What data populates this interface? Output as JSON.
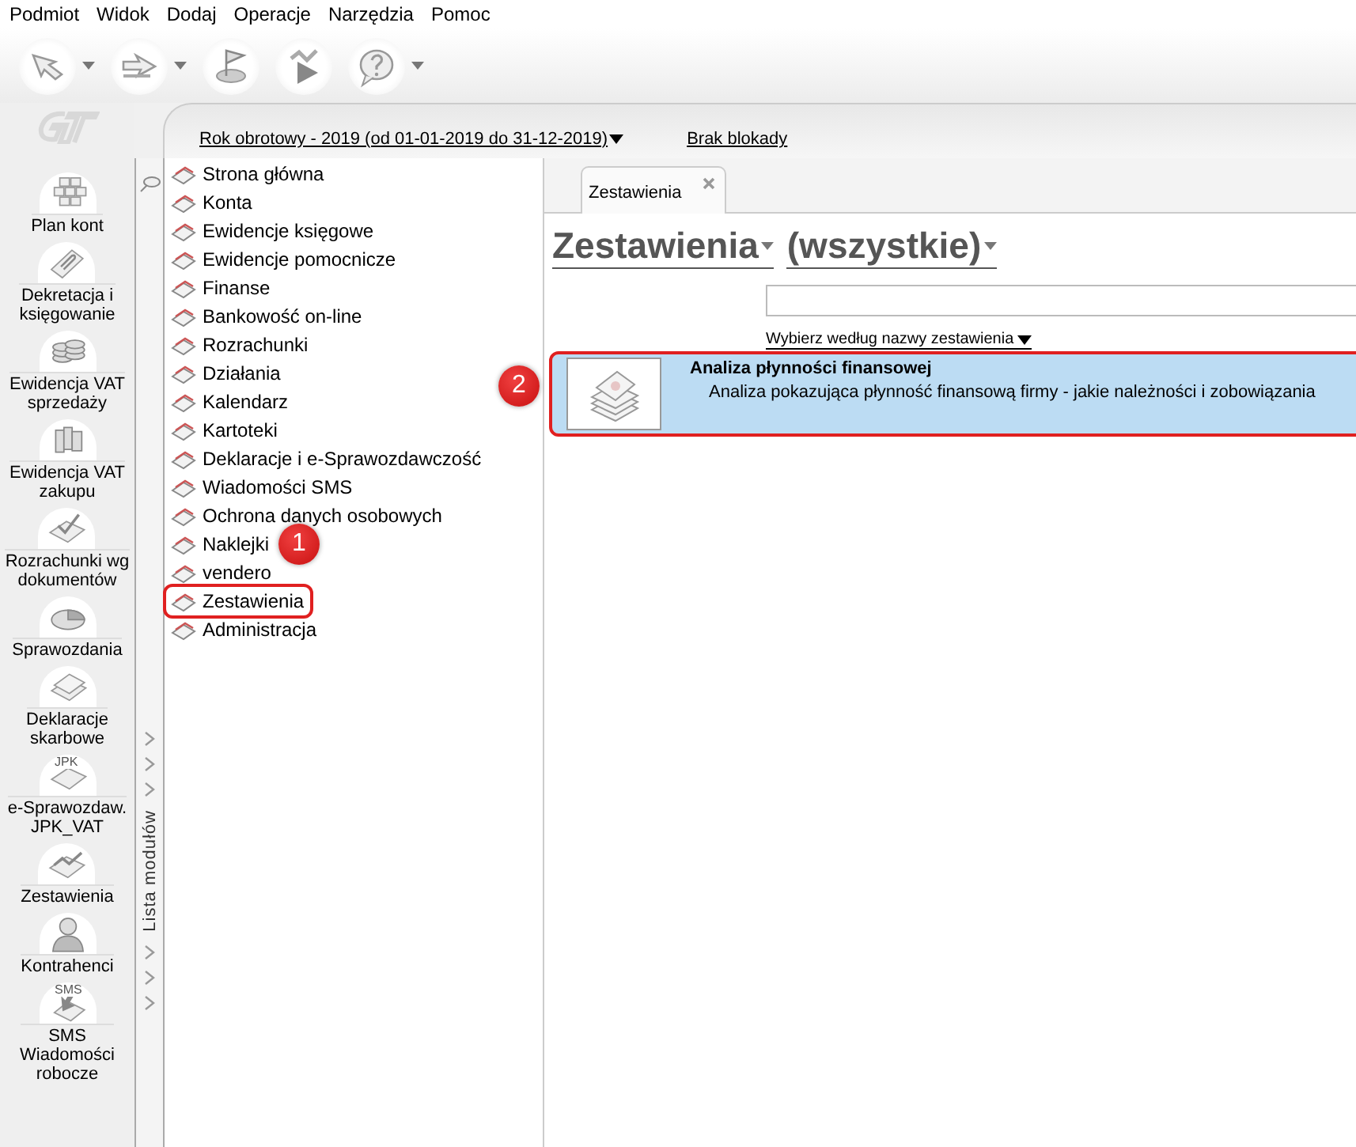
{
  "menu": [
    "Podmiot",
    "Widok",
    "Dodaj",
    "Operacje",
    "Narzędzia",
    "Pomoc"
  ],
  "toolbar": [
    {
      "kind": "arrow-left",
      "dropdown": true
    },
    {
      "kind": "arrow-right",
      "dropdown": true
    },
    {
      "kind": "flag",
      "dropdown": false
    },
    {
      "kind": "play",
      "dropdown": false
    },
    {
      "kind": "help",
      "dropdown": true
    }
  ],
  "sidebar": {
    "items": [
      {
        "label": "Plan kont",
        "kind": "grid"
      },
      {
        "label": "Dekretacja i\nksięgowanie",
        "kind": "clip"
      },
      {
        "label": "Ewidencja VAT\nsprzedaży",
        "kind": "coins"
      },
      {
        "label": "Ewidencja VAT\nzakupu",
        "kind": "binders"
      },
      {
        "label": "Rozrachunki wg\ndokumentów",
        "kind": "check"
      },
      {
        "label": "Sprawozdania",
        "kind": "pie"
      },
      {
        "label": "Deklaracje\nskarbowe",
        "kind": "stack"
      },
      {
        "label": "e-Sprawozdaw.\nJPK_VAT",
        "kind": "jpk",
        "badge": "JPK"
      },
      {
        "label": "Zestawienia",
        "kind": "chart"
      },
      {
        "label": "Kontrahenci",
        "kind": "person"
      },
      {
        "label": "SMS\nWiadomości\nrobocze",
        "kind": "sms",
        "badge": "SMS"
      }
    ]
  },
  "header": {
    "fiscal_year": "Rok obrotowy - 2019  (od 01-01-2019 do 31-12-2019)",
    "lock": "Brak blokady"
  },
  "module_strip": {
    "label": "Lista modułów"
  },
  "modules": [
    {
      "label": "Strona główna",
      "highlighted": false
    },
    {
      "label": "Konta",
      "highlighted": false
    },
    {
      "label": "Ewidencje księgowe",
      "highlighted": false
    },
    {
      "label": "Ewidencje pomocnicze",
      "highlighted": false
    },
    {
      "label": "Finanse",
      "highlighted": false
    },
    {
      "label": "Bankowość on-line",
      "highlighted": false
    },
    {
      "label": "Rozrachunki",
      "highlighted": false
    },
    {
      "label": "Działania",
      "highlighted": false
    },
    {
      "label": "Kalendarz",
      "highlighted": false
    },
    {
      "label": "Kartoteki",
      "highlighted": false
    },
    {
      "label": "Deklaracje i e-Sprawozdawczość",
      "highlighted": false
    },
    {
      "label": "Wiadomości SMS",
      "highlighted": false
    },
    {
      "label": "Ochrona danych osobowych",
      "highlighted": false
    },
    {
      "label": "Naklejki",
      "highlighted": false,
      "marker": "1"
    },
    {
      "label": "vendero",
      "highlighted": false
    },
    {
      "label": "Zestawienia",
      "highlighted": true
    },
    {
      "label": "Administracja",
      "highlighted": false
    }
  ],
  "tabs": [
    {
      "label": "Zestawienia",
      "selected": true
    }
  ],
  "filters": [
    {
      "label": "Zestawienia"
    },
    {
      "label": "(wszystkie)"
    }
  ],
  "search": {
    "sort_link": "Wybierz według nazwy zestawienia"
  },
  "reports": [
    {
      "title": "Analiza płynności finansowej",
      "description": "Analiza pokazująca płynność finansową firmy - jakie należności i zobowiązania",
      "selected": true,
      "highlighted": true,
      "marker": "2"
    }
  ]
}
